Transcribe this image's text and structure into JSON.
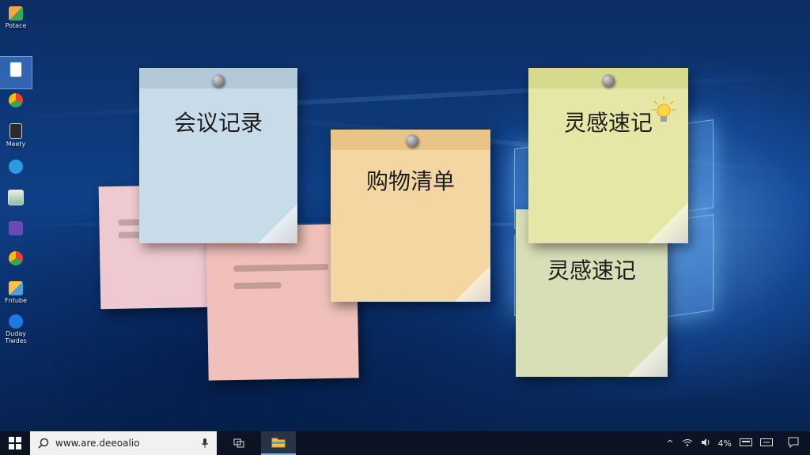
{
  "desktop_icons": [
    {
      "name": "Potace",
      "icon": "app-icon"
    },
    {
      "name": "",
      "icon": "document-icon"
    },
    {
      "name": "",
      "icon": "chrome-icon"
    },
    {
      "name": "Meety",
      "icon": "notes-icon"
    },
    {
      "name": "",
      "icon": "chat-icon"
    },
    {
      "name": "",
      "icon": "monitor-icon"
    },
    {
      "name": "",
      "icon": "vpn-icon"
    },
    {
      "name": "",
      "icon": "chrome-icon"
    },
    {
      "name": "Fntube",
      "icon": "app-icon"
    },
    {
      "name": "Duday Tiwdes",
      "icon": "edge-icon"
    }
  ],
  "notes": [
    {
      "title": "会议记录",
      "color": "#c7dbe9"
    },
    {
      "title": "购物清单",
      "color": "#f4d6a3"
    },
    {
      "title": "灵感速记",
      "color": "#e6e7a7"
    },
    {
      "title": "灵感速记",
      "color": "#d8dfb7"
    },
    {
      "title": "",
      "color": "#f1c0bb"
    },
    {
      "title": "",
      "color": "#eec9d1"
    }
  ],
  "lightbulb_icon": "lightbulb-icon",
  "taskbar": {
    "start_icon": "windows-start-icon",
    "search_text": "www.are.deeoalio",
    "search_icon": "search-icon",
    "mic_icon": "microphone-icon",
    "taskview_icon": "task-view-icon",
    "explorer_icon": "file-explorer-icon",
    "tray": {
      "chevron": "^",
      "network": "wifi-icon",
      "volume": "volume-icon",
      "battery": "4%",
      "keyboard": "keyboard-icon",
      "notifications": "notification-icon"
    }
  }
}
